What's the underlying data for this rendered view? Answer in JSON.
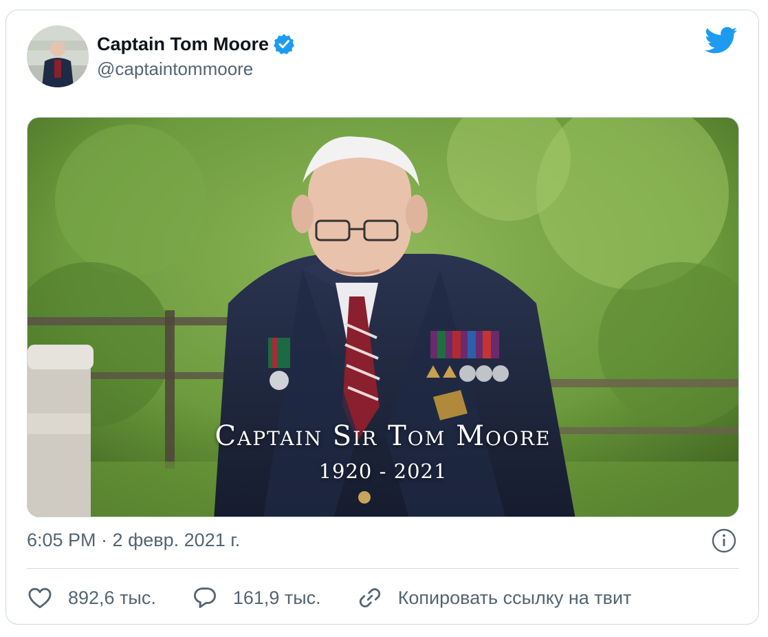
{
  "author": {
    "display_name": "Captain Tom Moore",
    "handle": "@captaintommoore",
    "verified": true
  },
  "media": {
    "overlay_title": "Captain Sir Tom Moore",
    "overlay_years": "1920 - 2021"
  },
  "timestamp": "6:05 PM · 2 февр. 2021 г.",
  "actions": {
    "likes": "892,6 тыс.",
    "replies": "161,9 тыс.",
    "copy_link": "Копировать ссылку на твит"
  },
  "icons": {
    "brand": "twitter-bird-icon",
    "verified": "verified-badge-icon",
    "info": "info-icon",
    "like": "heart-icon",
    "reply": "reply-bubble-icon",
    "link": "link-icon"
  },
  "colors": {
    "accent": "#1d9bf0",
    "text_primary": "#0f1419",
    "text_secondary": "#536471",
    "border": "#cfd9de"
  }
}
